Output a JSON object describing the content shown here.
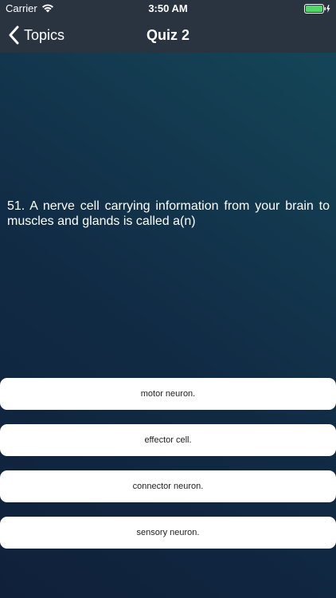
{
  "status_bar": {
    "carrier": "Carrier",
    "time": "3:50 AM",
    "battery_color": "#4cd964"
  },
  "nav": {
    "back_label": "Topics",
    "title": "Quiz 2"
  },
  "question": {
    "text": "51. A nerve cell carrying information from your brain to muscles and glands is called a(n)"
  },
  "answers": [
    {
      "label": "motor neuron."
    },
    {
      "label": "effector cell."
    },
    {
      "label": "connector neuron."
    },
    {
      "label": "sensory neuron."
    }
  ],
  "colors": {
    "bar_background": "#2a3441",
    "gradient_start": "#10203a",
    "gradient_end": "#15495a"
  }
}
